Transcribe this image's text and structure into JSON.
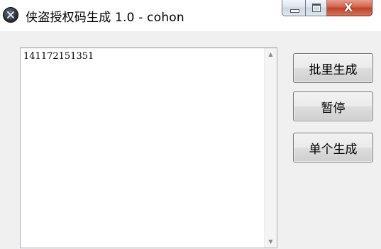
{
  "window": {
    "title": "侠盗授权码生成 1.0 - cohon",
    "icon": "app-logo-icon",
    "caption_buttons": {
      "minimize_icon": "minimize-icon",
      "maximize_icon": "maximize-icon",
      "close_glyph": "X"
    }
  },
  "output": {
    "text": "141172151351"
  },
  "buttons": {
    "batch_generate": "批里生成",
    "pause": "暂停",
    "single_generate": "单个生成"
  },
  "colors": {
    "client_bg": "#f0f0f0",
    "close_button": "#c2432a",
    "caption_button": "#dde4ec"
  }
}
